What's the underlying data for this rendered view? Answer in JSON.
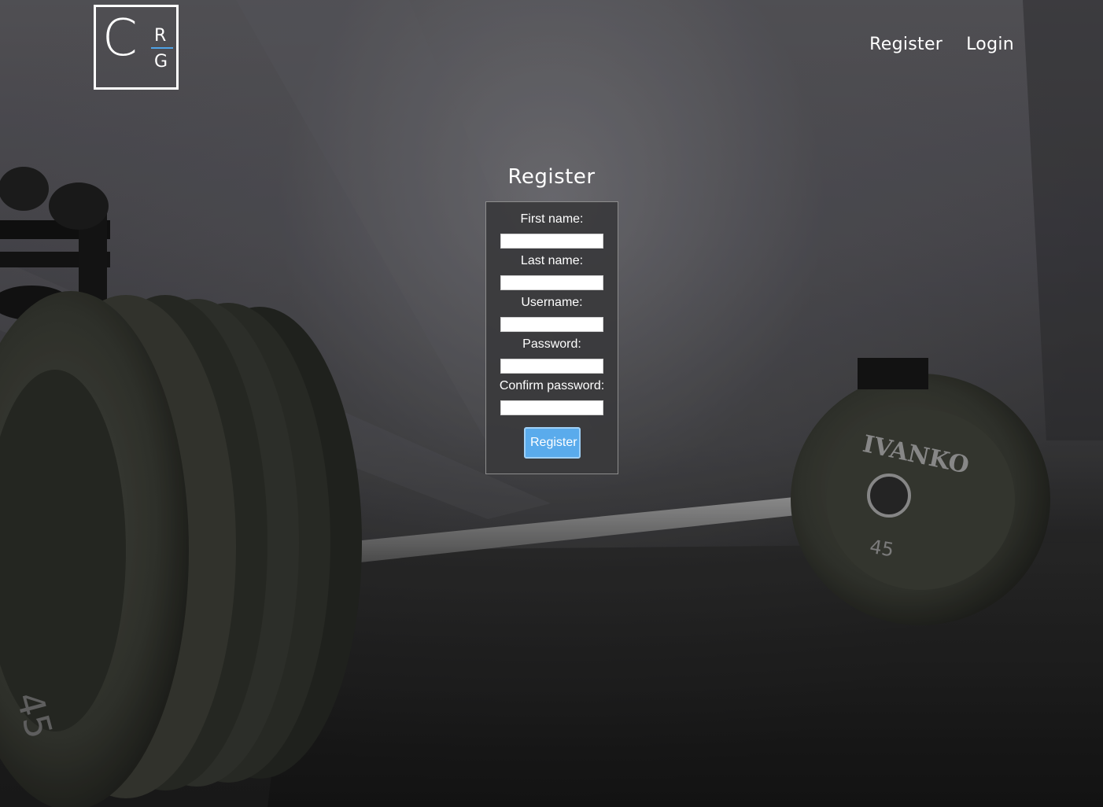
{
  "logo": {
    "main_letter": "C",
    "top_letter": "R",
    "bottom_letter": "G",
    "accent_color": "#4fa3e6"
  },
  "nav": {
    "register_label": "Register",
    "login_label": "Login"
  },
  "form": {
    "title": "Register",
    "fields": [
      {
        "label": "First name:",
        "value": ""
      },
      {
        "label": "Last name:",
        "value": ""
      },
      {
        "label": "Username:",
        "value": ""
      },
      {
        "label": "Password:",
        "value": ""
      },
      {
        "label": "Confirm password:",
        "value": ""
      }
    ],
    "submit_label": "Register",
    "submit_color": "#5aabec"
  },
  "background": {
    "plate_left_text": "45",
    "plate_right_brand": "IVANKO",
    "plate_right_text": "45"
  }
}
